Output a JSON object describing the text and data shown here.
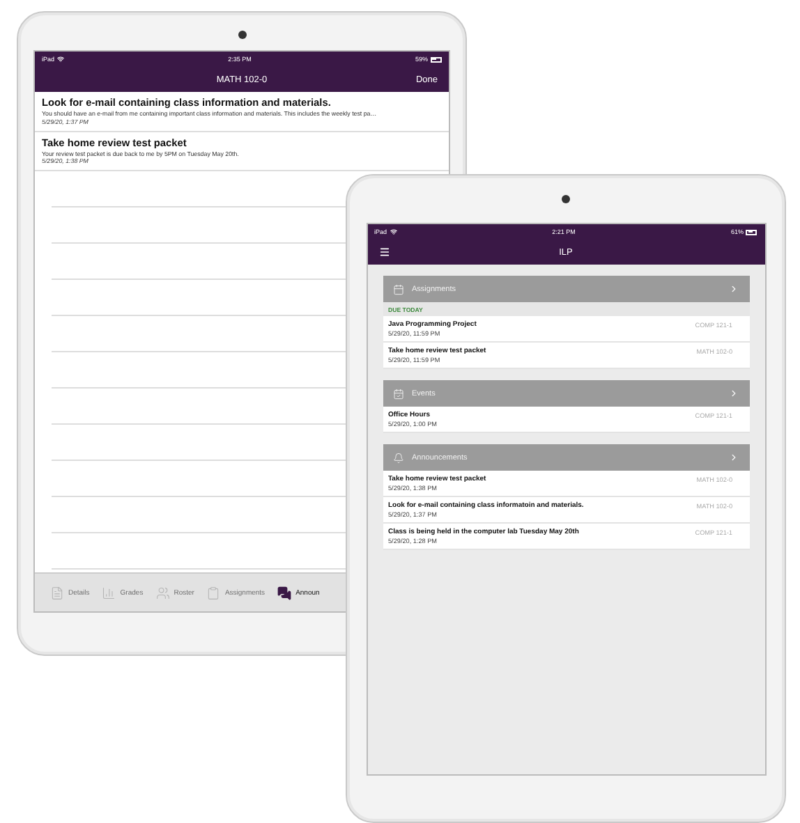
{
  "course_screen": {
    "status_bar": {
      "carrier": "iPad",
      "time": "2:35 PM",
      "battery": "59%"
    },
    "nav": {
      "title": "MATH 102-0",
      "action": "Done"
    },
    "announcements": [
      {
        "title": "Look for e-mail containing class information and materials.",
        "body": "You should have an e-mail from me containing important class information and materials. This includes the weekly test pa…",
        "date": "5/29/20, 1:37 PM"
      },
      {
        "title": "Take home review test packet",
        "body": "Your review test packet is due back to me by 5PM on Tuesday May 20th.",
        "date": "5/29/20, 1:38 PM"
      }
    ],
    "tabs": [
      {
        "kind": "details",
        "label": "Details",
        "selected": false
      },
      {
        "kind": "grades",
        "label": "Grades",
        "selected": false
      },
      {
        "kind": "roster",
        "label": "Roster",
        "selected": false
      },
      {
        "kind": "assignments",
        "label": "Assignments",
        "selected": false
      },
      {
        "kind": "announcements",
        "label": "Announ",
        "selected": true
      }
    ]
  },
  "home_screen": {
    "status_bar": {
      "carrier": "iPad",
      "time": "2:21 PM",
      "battery": "61%"
    },
    "nav": {
      "title": "ILP"
    },
    "sections": [
      {
        "kind": "assignments",
        "title": "Assignments",
        "group_label": "DUE TODAY",
        "items": [
          {
            "title": "Java Programming Project",
            "date": "5/29/20, 11:59 PM",
            "course": "COMP 121-1"
          },
          {
            "title": "Take home review test packet",
            "date": "5/29/20, 11:59 PM",
            "course": "MATH 102-0"
          }
        ]
      },
      {
        "kind": "events",
        "title": "Events",
        "items": [
          {
            "title": "Office Hours",
            "date": "5/29/20, 1:00 PM",
            "course": "COMP 121-1"
          }
        ]
      },
      {
        "kind": "announcements",
        "title": "Announcements",
        "items": [
          {
            "title": "Take home review test packet",
            "date": "5/29/20, 1:38 PM",
            "course": "MATH 102-0"
          },
          {
            "title": "Look for e-mail containing class informatoin and materials.",
            "date": "5/29/20, 1:37 PM",
            "course": "MATH 102-0"
          },
          {
            "title": "Class is being held in the computer lab Tuesday May 20th",
            "date": "5/29/20, 1:28 PM",
            "course": "COMP 121-1"
          }
        ]
      }
    ]
  }
}
